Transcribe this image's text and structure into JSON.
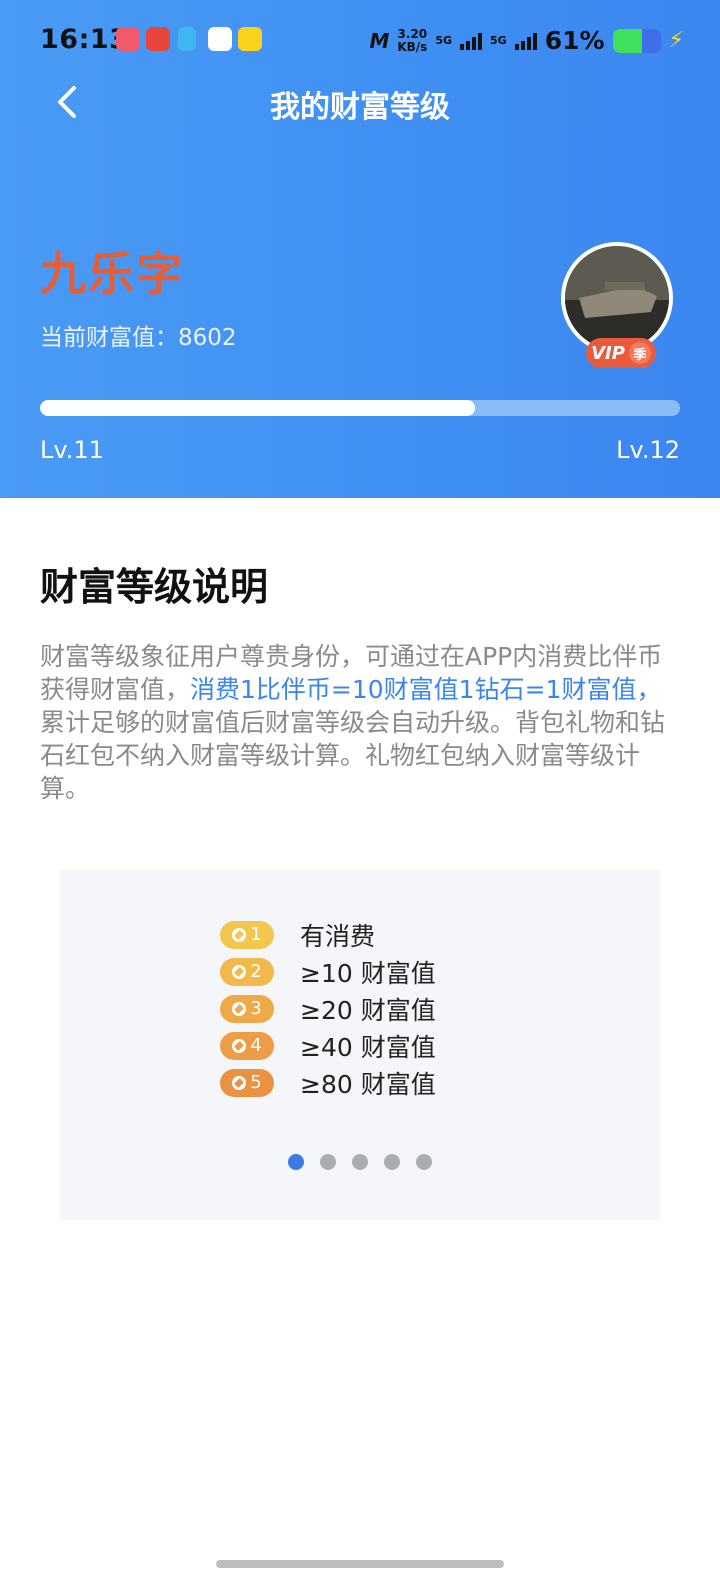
{
  "status_bar": {
    "time": "16:13",
    "net_speed_value": "3.20",
    "net_speed_unit": "KB/s",
    "signal_label": "5G",
    "battery_pct": "61%"
  },
  "header": {
    "title": "我的财富等级",
    "username": "九乐字",
    "wealth_text": "当前财富值：8602",
    "vip_label": "VIP",
    "vip_season": "季",
    "progress": 0.68,
    "level_current": "Lv.11",
    "level_next": "Lv.12"
  },
  "explanation": {
    "title": "财富等级说明",
    "text_before": "财富等级象征用户尊贵身份，可通过在APP内消费比伴币获得财富值，",
    "text_highlight": "消费1比伴币=10财富值1钻石=1财富值，",
    "text_after": "累计足够的财富值后财富等级会自动升级。背包礼物和钻石红包不纳入财富等级计算。礼物红包纳入财富等级计算。"
  },
  "levels": [
    {
      "num": "1",
      "label": "有消费",
      "color": "#f3c64e"
    },
    {
      "num": "2",
      "label": "≥10 财富值",
      "color": "#f1b84a"
    },
    {
      "num": "3",
      "label": "≥20 财富值",
      "color": "#efaa48"
    },
    {
      "num": "4",
      "label": "≥40 财富值",
      "color": "#ec9d45"
    },
    {
      "num": "5",
      "label": "≥80 财富值",
      "color": "#ea9142"
    }
  ],
  "carousel": {
    "pages": 5,
    "active": 0
  },
  "colors": {
    "header_blue": "#3f8ff3",
    "username_red": "#e85d33",
    "highlight_blue": "#3a86ee"
  }
}
